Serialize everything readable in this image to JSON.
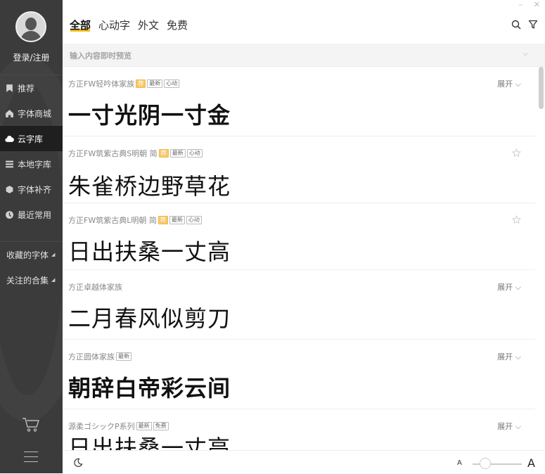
{
  "sidebar": {
    "login": "登录/注册",
    "nav": [
      {
        "label": "推荐",
        "icon": "bookmark-icon"
      },
      {
        "label": "字体商城",
        "icon": "home-icon"
      },
      {
        "label": "云字库",
        "icon": "cloud-icon"
      },
      {
        "label": "本地字库",
        "icon": "list-icon"
      },
      {
        "label": "字体补齐",
        "icon": "cube-icon"
      },
      {
        "label": "最近常用",
        "icon": "clock-icon"
      }
    ],
    "active_index": 2,
    "collections": [
      {
        "label": "收藏的字体"
      },
      {
        "label": "关注的合集"
      }
    ]
  },
  "window": {
    "minimize": "–",
    "close": "✕"
  },
  "tabs": [
    {
      "label": "全部"
    },
    {
      "label": "心动字"
    },
    {
      "label": "外文"
    },
    {
      "label": "免费"
    }
  ],
  "active_tab": 0,
  "search": {
    "placeholder": "输入内容即时预览"
  },
  "fonts": [
    {
      "name": "方正FW轻吟体家族",
      "badges": [
        "荐",
        "最新",
        "心动"
      ],
      "action": "展开",
      "preview": "一寸光阴一寸金"
    },
    {
      "name": "方正FW筑紫古典S明朝 简",
      "badges": [
        "荐",
        "最新",
        "心动"
      ],
      "action": "",
      "preview": "朱雀桥边野草花"
    },
    {
      "name": "方正FW筑紫古典L明朝 简",
      "badges": [
        "荐",
        "最新",
        "心动"
      ],
      "action": "",
      "preview": "日出扶桑一丈高"
    },
    {
      "name": "方正卓越体家族",
      "badges": [],
      "action": "展开",
      "preview": "二月春风似剪刀"
    },
    {
      "name": "方正圆体家族",
      "badges": [
        "最新"
      ],
      "action": "展开",
      "preview": "朝辞白帝彩云间"
    },
    {
      "name": "源柔ゴシックP系列",
      "badges": [
        "最新",
        "免费"
      ],
      "action": "展开",
      "preview": "日出扶桑一丈高"
    }
  ],
  "bottom": {
    "size_small": "A",
    "size_big": "A",
    "preview_size": 0.15
  }
}
